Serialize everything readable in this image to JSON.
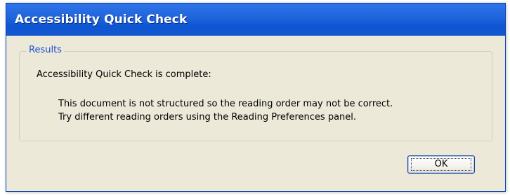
{
  "dialog": {
    "title": "Accessibility Quick Check",
    "group_label": "Results",
    "heading": "Accessibility Quick Check is complete:",
    "lines": [
      "This document is not structured so the reading order may not be correct.",
      "Try different reading orders using the Reading Preferences panel."
    ],
    "ok_label": "OK"
  },
  "colors": {
    "titlebar": "#0d55d3",
    "background": "#ece9d8",
    "group_label": "#1a4fd0"
  }
}
